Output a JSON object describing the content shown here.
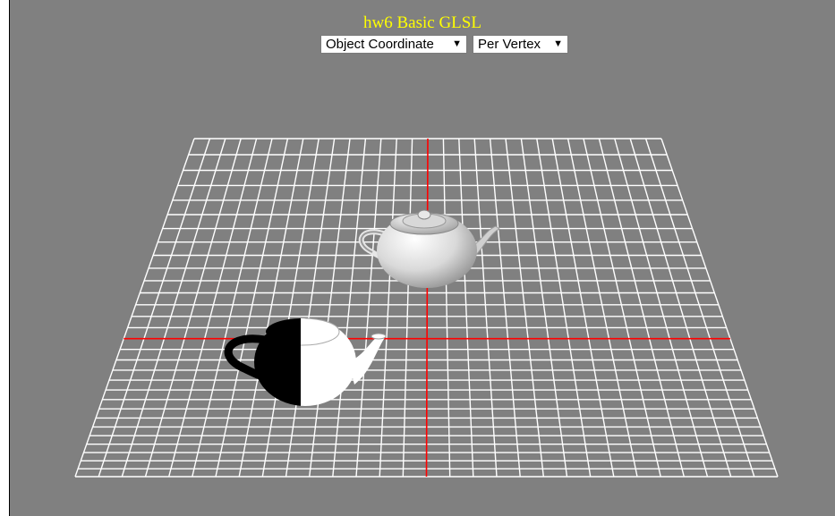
{
  "app": {
    "title": "hw6 Basic GLSL"
  },
  "controls": {
    "coordinate_select": {
      "value": "Object Coordinate",
      "arrow": "▼"
    },
    "shading_select": {
      "value": "Per Vertex",
      "arrow": "▼"
    }
  },
  "colors": {
    "background": "#808080",
    "title": "#ffff00",
    "grid": "#ffffff",
    "axis": "#ff0000"
  },
  "scene": {
    "grid_divisions": 30,
    "objects": [
      "teapot-lit",
      "teapot-half-shaded"
    ]
  }
}
